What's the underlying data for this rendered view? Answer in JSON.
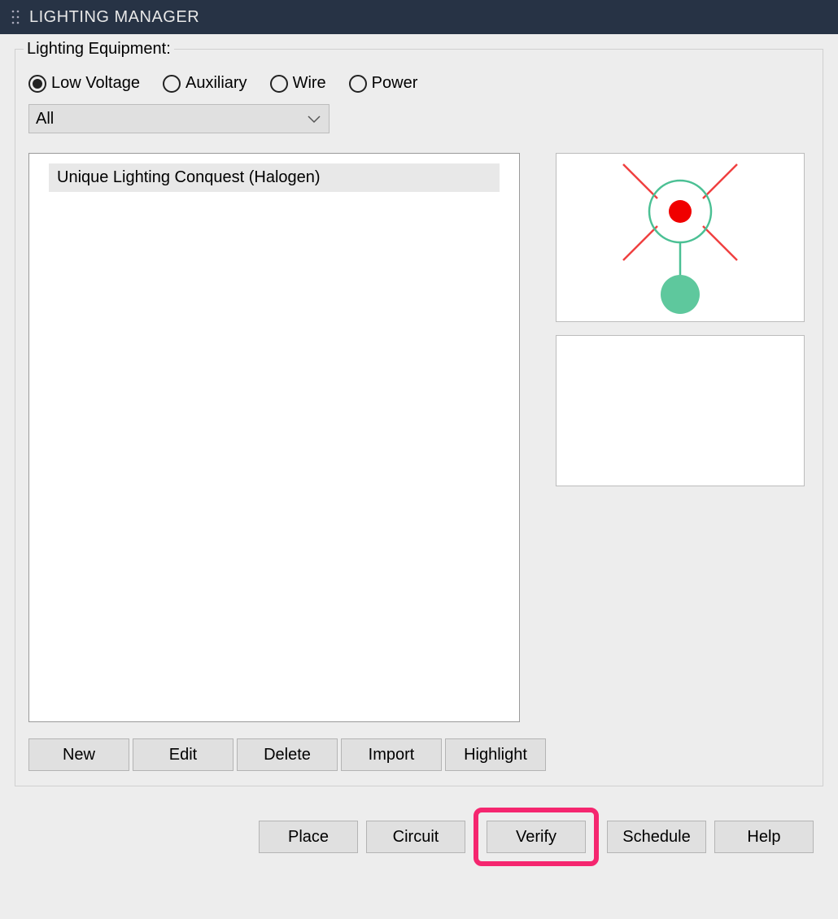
{
  "titlebar": {
    "title": "LIGHTING MANAGER"
  },
  "fieldset": {
    "legend": "Lighting Equipment:",
    "radios": [
      {
        "label": "Low Voltage",
        "checked": true
      },
      {
        "label": "Auxiliary",
        "checked": false
      },
      {
        "label": "Wire",
        "checked": false
      },
      {
        "label": "Power",
        "checked": false
      }
    ],
    "dropdown": {
      "selected": "All"
    },
    "list": {
      "items": [
        "Unique Lighting Conquest (Halogen)"
      ]
    },
    "buttons1": {
      "new": "New",
      "edit": "Edit",
      "delete": "Delete",
      "import": "Import",
      "highlight": "Highlight"
    }
  },
  "buttons2": {
    "place": "Place",
    "circuit": "Circuit",
    "verify": "Verify",
    "schedule": "Schedule",
    "help": "Help"
  }
}
